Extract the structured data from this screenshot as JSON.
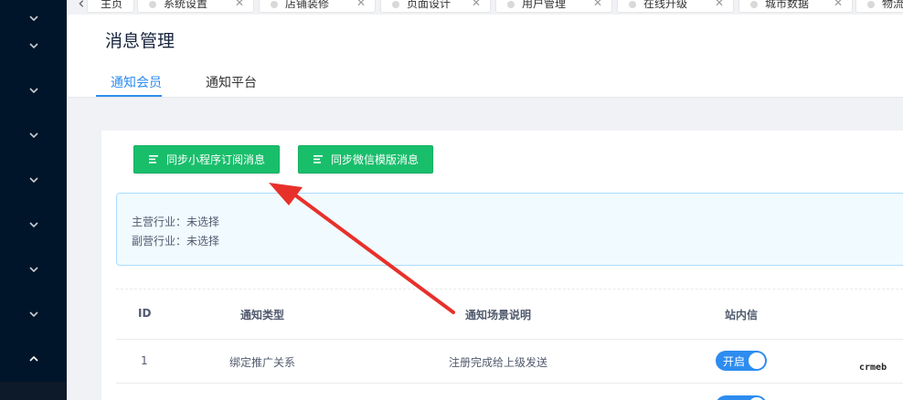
{
  "tabs": [
    {
      "label": "主页"
    },
    {
      "label": "系统设置"
    },
    {
      "label": "店铺装修"
    },
    {
      "label": "页面设计"
    },
    {
      "label": "用户管理"
    },
    {
      "label": "在线升级"
    },
    {
      "label": "城市数据"
    },
    {
      "label": "物流"
    }
  ],
  "page": {
    "title": "消息管理",
    "tabs": [
      "通知会员",
      "通知平台"
    ],
    "active_tab": 0
  },
  "actions": {
    "sync_miniprogram": "同步小程序订阅消息",
    "sync_wechat": "同步微信模版消息"
  },
  "info": {
    "main_industry": "主营行业：未选择",
    "sub_industry": "副营行业：未选择"
  },
  "table": {
    "headers": [
      "ID",
      "通知类型",
      "通知场景说明",
      "站内信"
    ],
    "rows": [
      {
        "id": "1",
        "type": "绑定推广关系",
        "scene": "注册完成给上级发送",
        "site_msg": "开启"
      }
    ]
  },
  "brand": "crmeb",
  "colors": {
    "sidebar": "#001529",
    "primary": "#2d8cf0",
    "success": "#19be6b",
    "annotation": "#e8302a"
  }
}
